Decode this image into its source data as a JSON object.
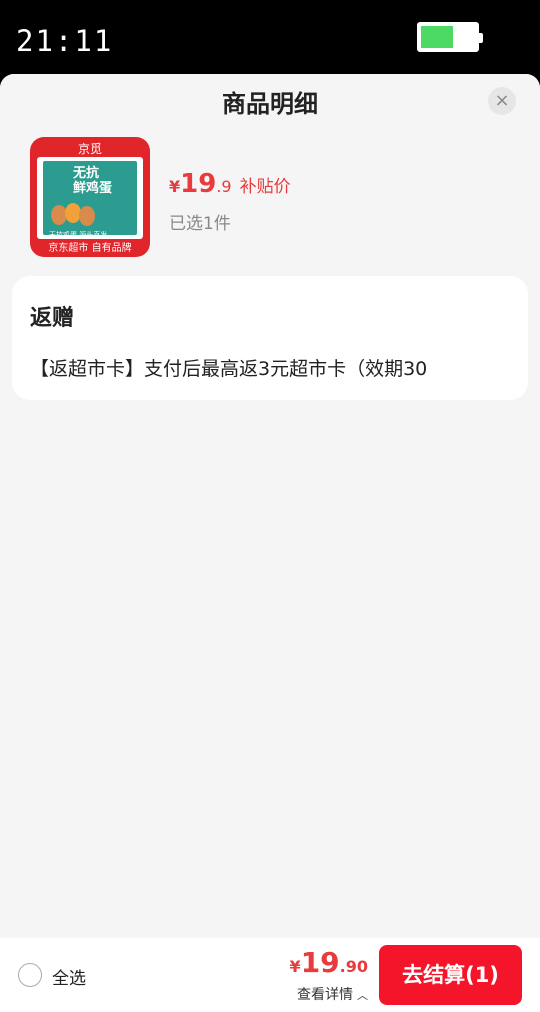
{
  "status_bar": {
    "time": "21:11"
  },
  "sheet": {
    "title": "商品明细",
    "close_symbol": "×"
  },
  "product": {
    "image": {
      "logo_text": "京觅",
      "box_text": "无抗\n鲜鸡蛋",
      "tags": "无抗鸡蛋  源头直发",
      "footer_text": "京东超市 自有品牌"
    },
    "price_symbol": "¥",
    "price_int": "19",
    "price_dec": ".9",
    "price_tag": "补贴价",
    "selected_count": "已选1件"
  },
  "gift": {
    "title": "返赠",
    "text": "【返超市卡】支付后最高返3元超市卡（效期30"
  },
  "bottom_bar": {
    "select_all_label": "全选",
    "total_symbol": "¥",
    "total_int": "19",
    "total_dec": ".90",
    "details_label": "查看详情",
    "details_icon": "chevron-up-icon",
    "checkout_label": "去结算(1)"
  },
  "colors": {
    "accent": "#e93b3d",
    "checkout": "#f5152b",
    "battery": "#4cd964"
  }
}
